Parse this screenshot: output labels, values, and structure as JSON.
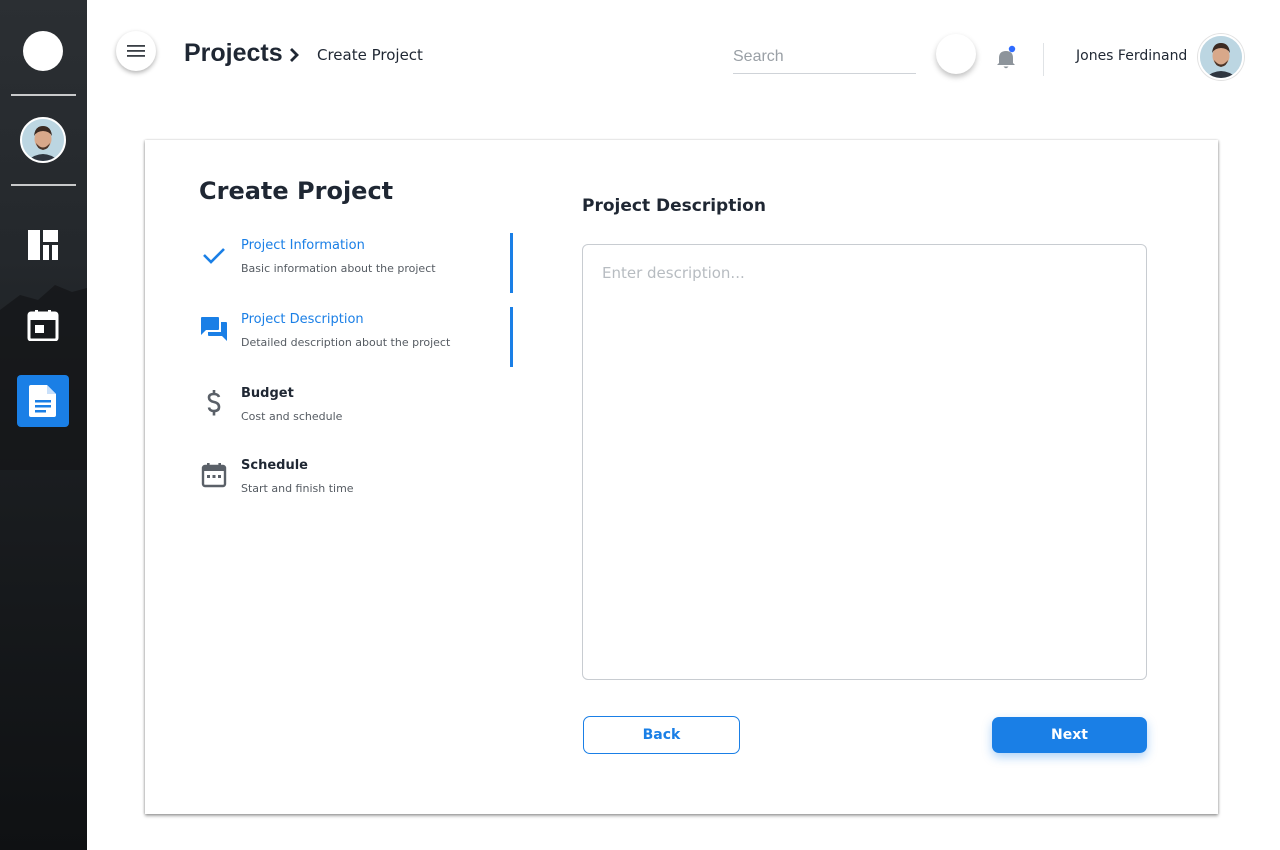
{
  "sidebar": {
    "logo_icon": "app-logo-circle",
    "items": [
      {
        "name": "dashboard",
        "icon": "dashboard-icon"
      },
      {
        "name": "calendar",
        "icon": "calendar-icon"
      },
      {
        "name": "documents",
        "icon": "document-icon",
        "active": true
      }
    ]
  },
  "header": {
    "breadcrumb_main": "Projects",
    "breadcrumb_sub": "Create Project",
    "search_placeholder": "Search",
    "user_name": "Jones Ferdinand",
    "notification_dot_color": "#2f6bff"
  },
  "card": {
    "title": "Create Project",
    "steps": [
      {
        "title": "Project Information",
        "subtitle": "Basic information about the project",
        "icon": "check-icon",
        "state": "completed"
      },
      {
        "title": "Project Description",
        "subtitle": "Detailed description about the project",
        "icon": "chat-icon",
        "state": "active"
      },
      {
        "title": "Budget",
        "subtitle": "Cost and schedule",
        "icon": "dollar-icon",
        "state": "pending"
      },
      {
        "title": "Schedule",
        "subtitle": "Start and finish time",
        "icon": "calendar-icon",
        "state": "pending"
      }
    ],
    "section_title": "Project Description",
    "description": {
      "value": "",
      "placeholder": "Enter description..."
    },
    "back_label": "Back",
    "next_label": "Next"
  },
  "colors": {
    "accent": "#1a7fe6",
    "text": "#1f2733",
    "sidebar_bg": "#1a1d20"
  }
}
